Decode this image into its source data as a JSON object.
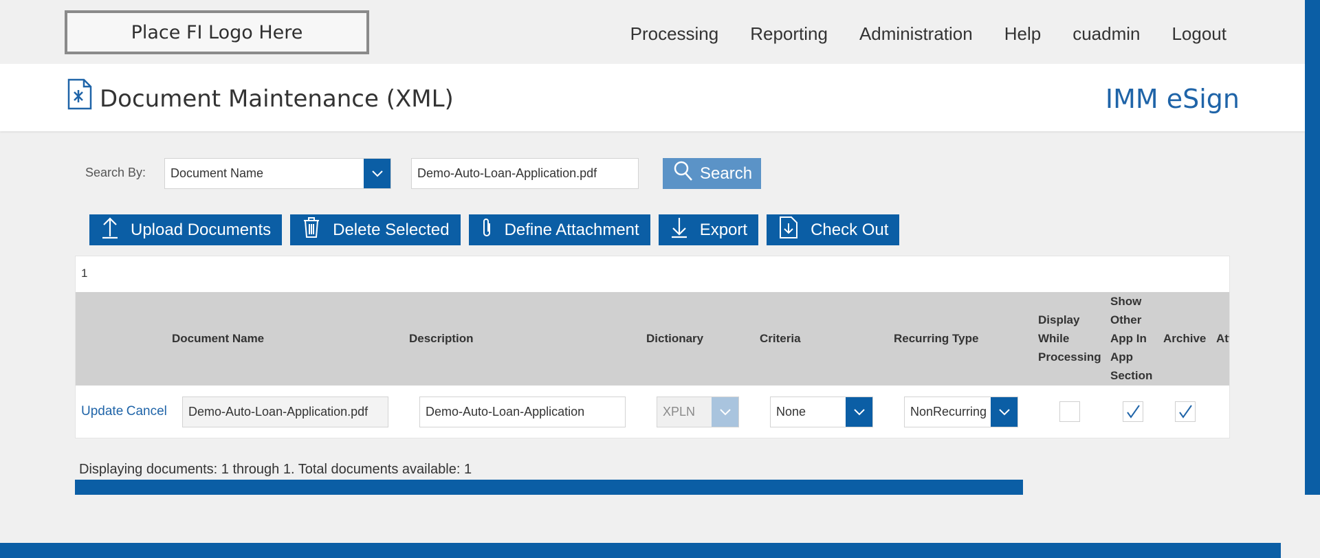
{
  "header": {
    "logo_text": "Place FI Logo Here",
    "nav": [
      "Processing",
      "Reporting",
      "Administration",
      "Help",
      "cuadmin",
      "Logout"
    ]
  },
  "title_bar": {
    "page_title": "Document Maintenance (XML)",
    "brand": "IMM eSign",
    "icon": "document-edit-icon"
  },
  "search": {
    "label": "Search By:",
    "field_value": "Document Name",
    "query": "Demo-Auto-Loan-Application.pdf",
    "button_label": "Search"
  },
  "toolbar": {
    "upload_label": "Upload Documents",
    "delete_label": "Delete Selected",
    "attach_label": "Define Attachment",
    "export_label": "Export",
    "checkout_label": "Check Out"
  },
  "grid": {
    "page_number": "1",
    "headers": {
      "document_name": "Document Name",
      "description": "Description",
      "dictionary": "Dictionary",
      "criteria": "Criteria",
      "recurring_type": "Recurring Type",
      "display_while_processing": [
        "Display",
        "While",
        "Processing"
      ],
      "show_other_app": [
        "Show",
        "Other",
        "App In",
        "App",
        "Section"
      ],
      "archive": "Archive",
      "attachment_truncated": "Att"
    },
    "row": {
      "update_link": "Update",
      "cancel_link": "Cancel",
      "document_name": "Demo-Auto-Loan-Application.pdf",
      "description": "Demo-Auto-Loan-Application",
      "dictionary": "XPLN",
      "criteria": "None",
      "recurring_type": "NonRecurring",
      "display_while_processing": false,
      "show_other_app": true,
      "archive": true
    }
  },
  "status": {
    "text": "Displaying documents: 1 through 1. Total documents available: 1"
  },
  "colors": {
    "primary": "#0b5ea5",
    "search_button": "#5b93c7",
    "link": "#1f64a8",
    "header_gray": "#d0d0d0"
  }
}
